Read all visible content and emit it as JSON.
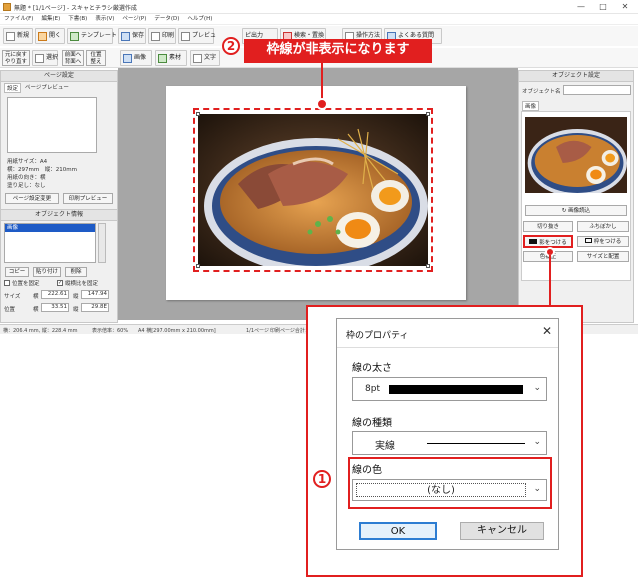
{
  "window": {
    "title": "無題 * [1/1ページ] - スキャとチラシ厳選作成",
    "min": "—",
    "max": "□",
    "close": "✕"
  },
  "menu": [
    "ファイル(F)",
    "編集(E)",
    "下書(B)",
    "表示(V)",
    "ページ(P)",
    "データ(D)",
    "ヘルプ(H)"
  ],
  "toolbar1": {
    "new": "新規",
    "open": "開く",
    "template": "テンプレート",
    "save": "保存",
    "print": "印刷",
    "preview": "プレビュ",
    "pdf": "ピ出力",
    "support": "検索・置換",
    "disp": "操作方法",
    "faq": "よくある質問"
  },
  "toolbar2": {
    "undo": "元に戻す",
    "redo": "やり直す",
    "select": "選択",
    "front": "前面へ",
    "back": "背面へ",
    "position": "位置",
    "align": "整え",
    "image": "画像",
    "material": "素材",
    "text": "文字"
  },
  "page_settings": {
    "header": "ページ設定",
    "tab_settings": "設定",
    "tab_preview": "ページプレビュー",
    "paper_size": "用紙サイズ：A4",
    "dims": "横：297mm　縦：210mm",
    "orientation": "用紙の向き：横",
    "bleed": "塗り足し：なし",
    "change_btn": "ページ設定変更",
    "print_preview_btn": "印刷プレビュー"
  },
  "object_info": {
    "header": "オブジェクト情報",
    "list_item": "画像",
    "copy": "コピー",
    "paste": "貼り付け",
    "delete": "削除",
    "lock_pos": "位置を固定",
    "lock_ratio": "縦横比を固定",
    "size_label": "サイズ",
    "w_label": "横",
    "w_val": "222.61",
    "h_label": "縦",
    "h_val": "147.94",
    "pos_label": "位置",
    "x_label": "横",
    "x_val": "33.51",
    "y_label": "縦",
    "y_val": "29.8E"
  },
  "object_settings": {
    "header": "オブジェクト設定",
    "name_label": "オブジェクト名",
    "name_value": "",
    "tab_image": "画像",
    "reload_btn": "画像読込",
    "crop_btn": "切り抜き",
    "blur_btn": "ふちぼかし",
    "shadow_btn": "影をつける",
    "frame_btn": "枠をつける",
    "adjust_btn": "色補正",
    "layout_btn": "サイズと配置"
  },
  "status": {
    "s1": "横：206.4 mm, 縦：228.4 mm",
    "s2": "表示倍率：60%",
    "s3": "A4 横[297.00mm x 210.00mm]",
    "s4": "1/1ページ",
    "s5": "印刷ページ合計：1"
  },
  "callouts": {
    "step1": "1",
    "step2": "2",
    "message": "枠線が非表示になります"
  },
  "dialog": {
    "title": "枠のプロパティ",
    "close": "✕",
    "width_label": "線の太さ",
    "width_value": "8pt",
    "type_label": "線の種類",
    "type_value": "実線",
    "color_label": "線の色",
    "color_value": "(なし)",
    "ok": "OK",
    "cancel": "キャンセル"
  },
  "colors": {
    "accent_red": "#e11f1f",
    "selection_blue": "#1e5bc6"
  }
}
